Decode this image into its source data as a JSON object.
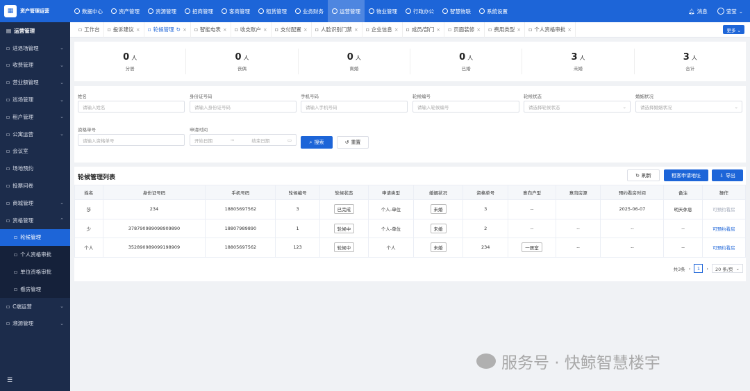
{
  "app": {
    "title": "资产管理运营",
    "logo_glyph": "▦"
  },
  "topnav": [
    {
      "label": "数据中心",
      "icon": "clock-icon"
    },
    {
      "label": "资产管理",
      "icon": "cube-icon"
    },
    {
      "label": "资源管理",
      "icon": "grid-icon"
    },
    {
      "label": "招商管理",
      "icon": "house-icon"
    },
    {
      "label": "客商管理",
      "icon": "group-icon"
    },
    {
      "label": "租赁管理",
      "icon": "building-icon"
    },
    {
      "label": "业务财务",
      "icon": "coin-icon"
    },
    {
      "label": "运营管理",
      "icon": "chart-icon",
      "active": true
    },
    {
      "label": "物业管理",
      "icon": "home-icon"
    },
    {
      "label": "行政办公",
      "icon": "phone-icon"
    },
    {
      "label": "智慧物联",
      "icon": "sensor-icon"
    },
    {
      "label": "系统设置",
      "icon": "gear-icon"
    }
  ],
  "topright": {
    "messages": "消息",
    "user": "莹莹"
  },
  "sidebar": {
    "head": "运营管理",
    "items": [
      {
        "label": "进退场管理",
        "chev": "⌄"
      },
      {
        "label": "收费管理",
        "chev": "⌄"
      },
      {
        "label": "营业额管理",
        "chev": "⌄"
      },
      {
        "label": "巡场管理",
        "chev": "⌄"
      },
      {
        "label": "租户管理",
        "chev": "⌄"
      },
      {
        "label": "公寓运营",
        "chev": "⌄"
      },
      {
        "label": "会议室",
        "chev": ""
      },
      {
        "label": "场地预约",
        "chev": ""
      },
      {
        "label": "投票问卷",
        "chev": ""
      },
      {
        "label": "商城管理",
        "chev": "⌄"
      },
      {
        "label": "资格管理",
        "chev": "⌃"
      }
    ],
    "subs": [
      {
        "label": "轮候管理",
        "active": true
      },
      {
        "label": "个人资格审批"
      },
      {
        "label": "单位资格审批"
      },
      {
        "label": "看房管理"
      }
    ],
    "after": [
      {
        "label": "C端运营",
        "chev": "⌄"
      },
      {
        "label": "溯源管理",
        "chev": "⌄"
      }
    ],
    "toggle": "☰"
  },
  "tabs": [
    {
      "label": "工作台",
      "close": ""
    },
    {
      "label": "投诉建议",
      "close": "×"
    },
    {
      "label": "轮候管理",
      "close": "×",
      "active": true,
      "refresh": "↻"
    },
    {
      "label": "智能电表",
      "close": "×"
    },
    {
      "label": "收支账户",
      "close": "×"
    },
    {
      "label": "支付配置",
      "close": "×"
    },
    {
      "label": "人脸识别门禁",
      "close": "×"
    },
    {
      "label": "企业信息",
      "close": "×"
    },
    {
      "label": "成员/部门",
      "close": "×"
    },
    {
      "label": "页面装修",
      "close": "×"
    },
    {
      "label": "费用类型",
      "close": "×"
    },
    {
      "label": "个人资格审批",
      "close": "×"
    }
  ],
  "more_label": "更多 ⌄",
  "stats": [
    {
      "value": "0",
      "unit": "人",
      "label": "分居"
    },
    {
      "value": "0",
      "unit": "人",
      "label": "丧偶"
    },
    {
      "value": "0",
      "unit": "人",
      "label": "离婚"
    },
    {
      "value": "0",
      "unit": "人",
      "label": "已婚"
    },
    {
      "value": "3",
      "unit": "人",
      "label": "未婚"
    },
    {
      "value": "3",
      "unit": "人",
      "label": "合计"
    }
  ],
  "filters": {
    "name": {
      "label": "姓名",
      "placeholder": "请输入姓名"
    },
    "idcard": {
      "label": "身份证号码",
      "placeholder": "请输入身份证号码"
    },
    "phone": {
      "label": "手机号码",
      "placeholder": "请输入手机号码"
    },
    "queue_no": {
      "label": "轮候编号",
      "placeholder": "请输入轮候编号"
    },
    "queue_status": {
      "label": "轮候状态",
      "placeholder": "请选择轮候状态"
    },
    "marital": {
      "label": "婚姻状况",
      "placeholder": "请选择婚姻状况"
    },
    "qual_no": {
      "label": "资格单号",
      "placeholder": "请输入资格单号"
    },
    "apply_time": {
      "label": "申请时间",
      "start": "开始日期",
      "sep": "→",
      "end": "结束日期"
    },
    "search_label": "搜索",
    "reset_label": "重置"
  },
  "list": {
    "title": "轮候管理列表",
    "refresh_label": "刷新",
    "apply_label": "租客申请地址",
    "export_label": "导出",
    "columns": [
      "姓名",
      "身份证号码",
      "手机号码",
      "轮候编号",
      "轮候状态",
      "申请类型",
      "婚姻状况",
      "资格单号",
      "意向户型",
      "意向房源",
      "预约看房时间",
      "备注",
      "操作"
    ],
    "rows": [
      {
        "name": "莎",
        "idcard": "234",
        "phone": "18805697562",
        "queue_no": "3",
        "status": "已完成",
        "type": "个人-单位",
        "marital": "未婚",
        "qual_no": "3",
        "layout": "--",
        "house": "",
        "visit": "2025-06-07",
        "note": "明天休息",
        "op": "可预约看房",
        "op_muted": true
      },
      {
        "name": "少",
        "idcard": "378790989098909890",
        "phone": "18807989890",
        "queue_no": "1",
        "status": "轮候中",
        "type": "个人-单位",
        "marital": "未婚",
        "qual_no": "2",
        "layout": "--",
        "house": "--",
        "visit": "--",
        "note": "--",
        "op": "可预约看房",
        "op_muted": false
      },
      {
        "name": "个人",
        "idcard": "352890989099198909",
        "phone": "18805697562",
        "queue_no": "123",
        "status": "轮候中",
        "type": "个人",
        "marital": "未婚",
        "qual_no": "234",
        "layout": "一居室",
        "house": "--",
        "visit": "--",
        "note": "--",
        "op": "可预约看房",
        "op_muted": false
      }
    ]
  },
  "pager": {
    "total": "共3条",
    "prev": "‹",
    "page": "1",
    "next": "›",
    "size": "20 条/页"
  },
  "watermark": "服务号 · 快鲸智慧楼宇"
}
